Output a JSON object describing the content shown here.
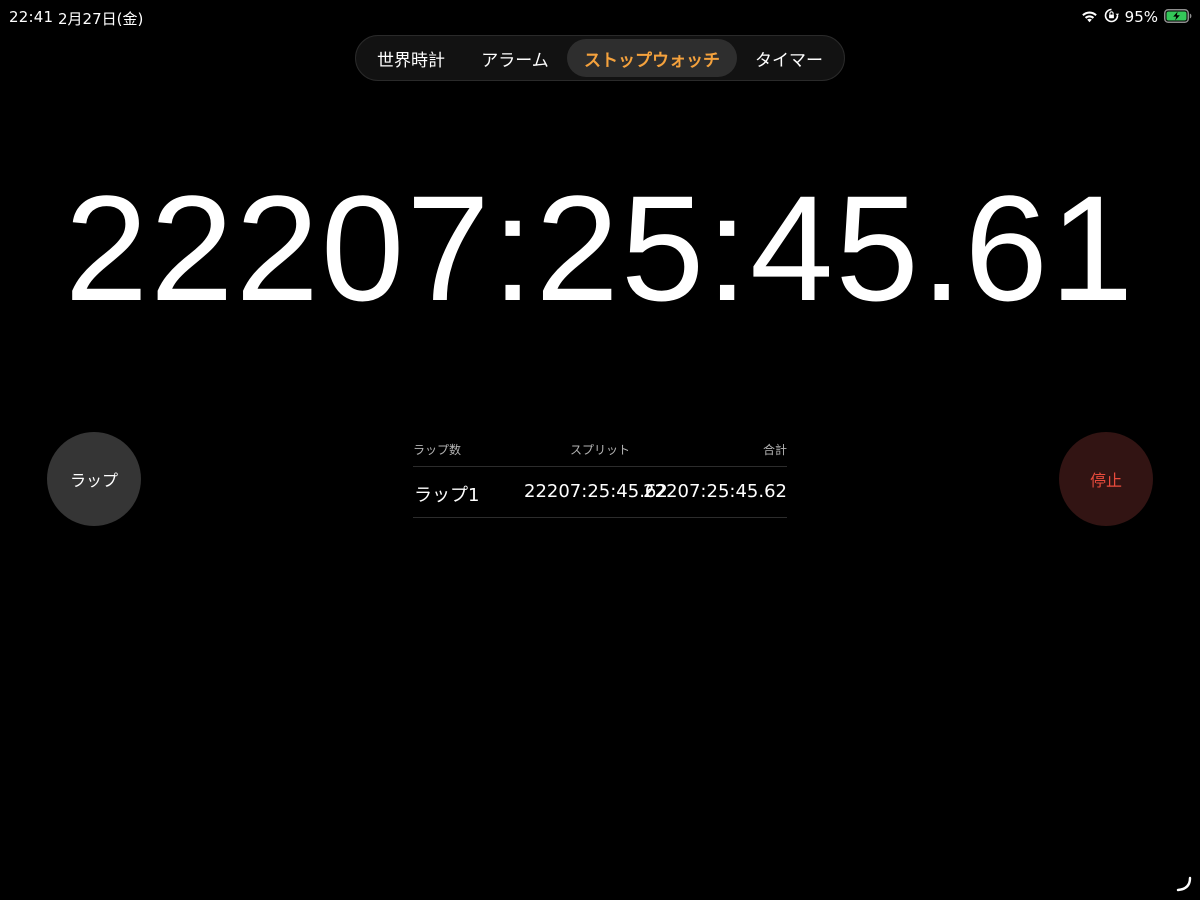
{
  "status_bar": {
    "time": "22:41",
    "date": "2月27日(金)",
    "battery_percent": "95%",
    "battery_level": 0.95,
    "icons": [
      "wifi-icon",
      "orientation-lock-icon",
      "battery-charging-icon"
    ]
  },
  "tabs": [
    {
      "label": "世界時計",
      "active": false
    },
    {
      "label": "アラーム",
      "active": false
    },
    {
      "label": "ストップウォッチ",
      "active": true
    },
    {
      "label": "タイマー",
      "active": false
    }
  ],
  "timer": {
    "display": "22207:25:45.61"
  },
  "buttons": {
    "lap_label": "ラップ",
    "stop_label": "停止"
  },
  "laps": {
    "headers": {
      "lap": "ラップ数",
      "split": "スプリット",
      "total": "合計"
    },
    "rows": [
      {
        "lap": "ラップ1",
        "split": "22207:25:45.62",
        "total": "22207:25:45.62"
      }
    ]
  },
  "colors": {
    "background": "#000000",
    "accent": "#f5a23d",
    "stop_text": "#e94b3c",
    "stop_bg": "#321413",
    "lap_bg": "#353535",
    "battery_green": "#34c759"
  }
}
